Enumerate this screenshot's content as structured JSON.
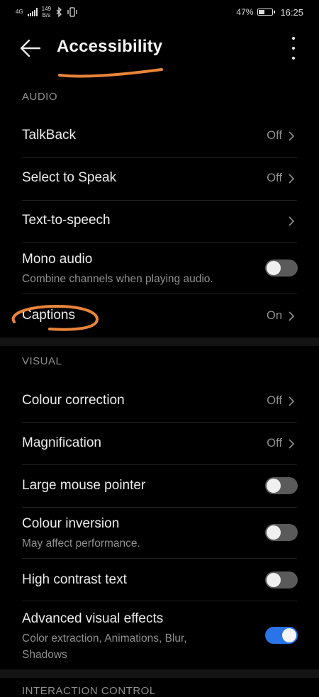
{
  "status_bar": {
    "network": "4G",
    "speed_value": "149",
    "speed_unit": "B/s",
    "battery": "47%",
    "battery_level": 0.47,
    "time": "16:25"
  },
  "header": {
    "title": "Accessibility"
  },
  "sections": {
    "audio": {
      "title": "AUDIO",
      "items": [
        {
          "label": "TalkBack",
          "value": "Off"
        },
        {
          "label": "Select to Speak",
          "value": "Off"
        },
        {
          "label": "Text-to-speech",
          "value": ""
        },
        {
          "label": "Mono audio",
          "subtitle": "Combine channels when playing audio.",
          "toggle": false
        },
        {
          "label": "Captions",
          "value": "On"
        }
      ]
    },
    "visual": {
      "title": "VISUAL",
      "items": [
        {
          "label": "Colour correction",
          "value": "Off"
        },
        {
          "label": "Magnification",
          "value": "Off"
        },
        {
          "label": "Large mouse pointer",
          "toggle": false
        },
        {
          "label": "Colour inversion",
          "subtitle": "May affect performance.",
          "toggle": false
        },
        {
          "label": "High contrast text",
          "toggle": false
        },
        {
          "label": "Advanced visual effects",
          "subtitle": "Color extraction, Animations, Blur, Shadows",
          "toggle": true
        }
      ]
    },
    "interaction": {
      "title": "INTERACTION CONTROL"
    }
  },
  "colors": {
    "background": "#000000",
    "accent": "#2a73e8",
    "annotation": "#e8853a"
  }
}
